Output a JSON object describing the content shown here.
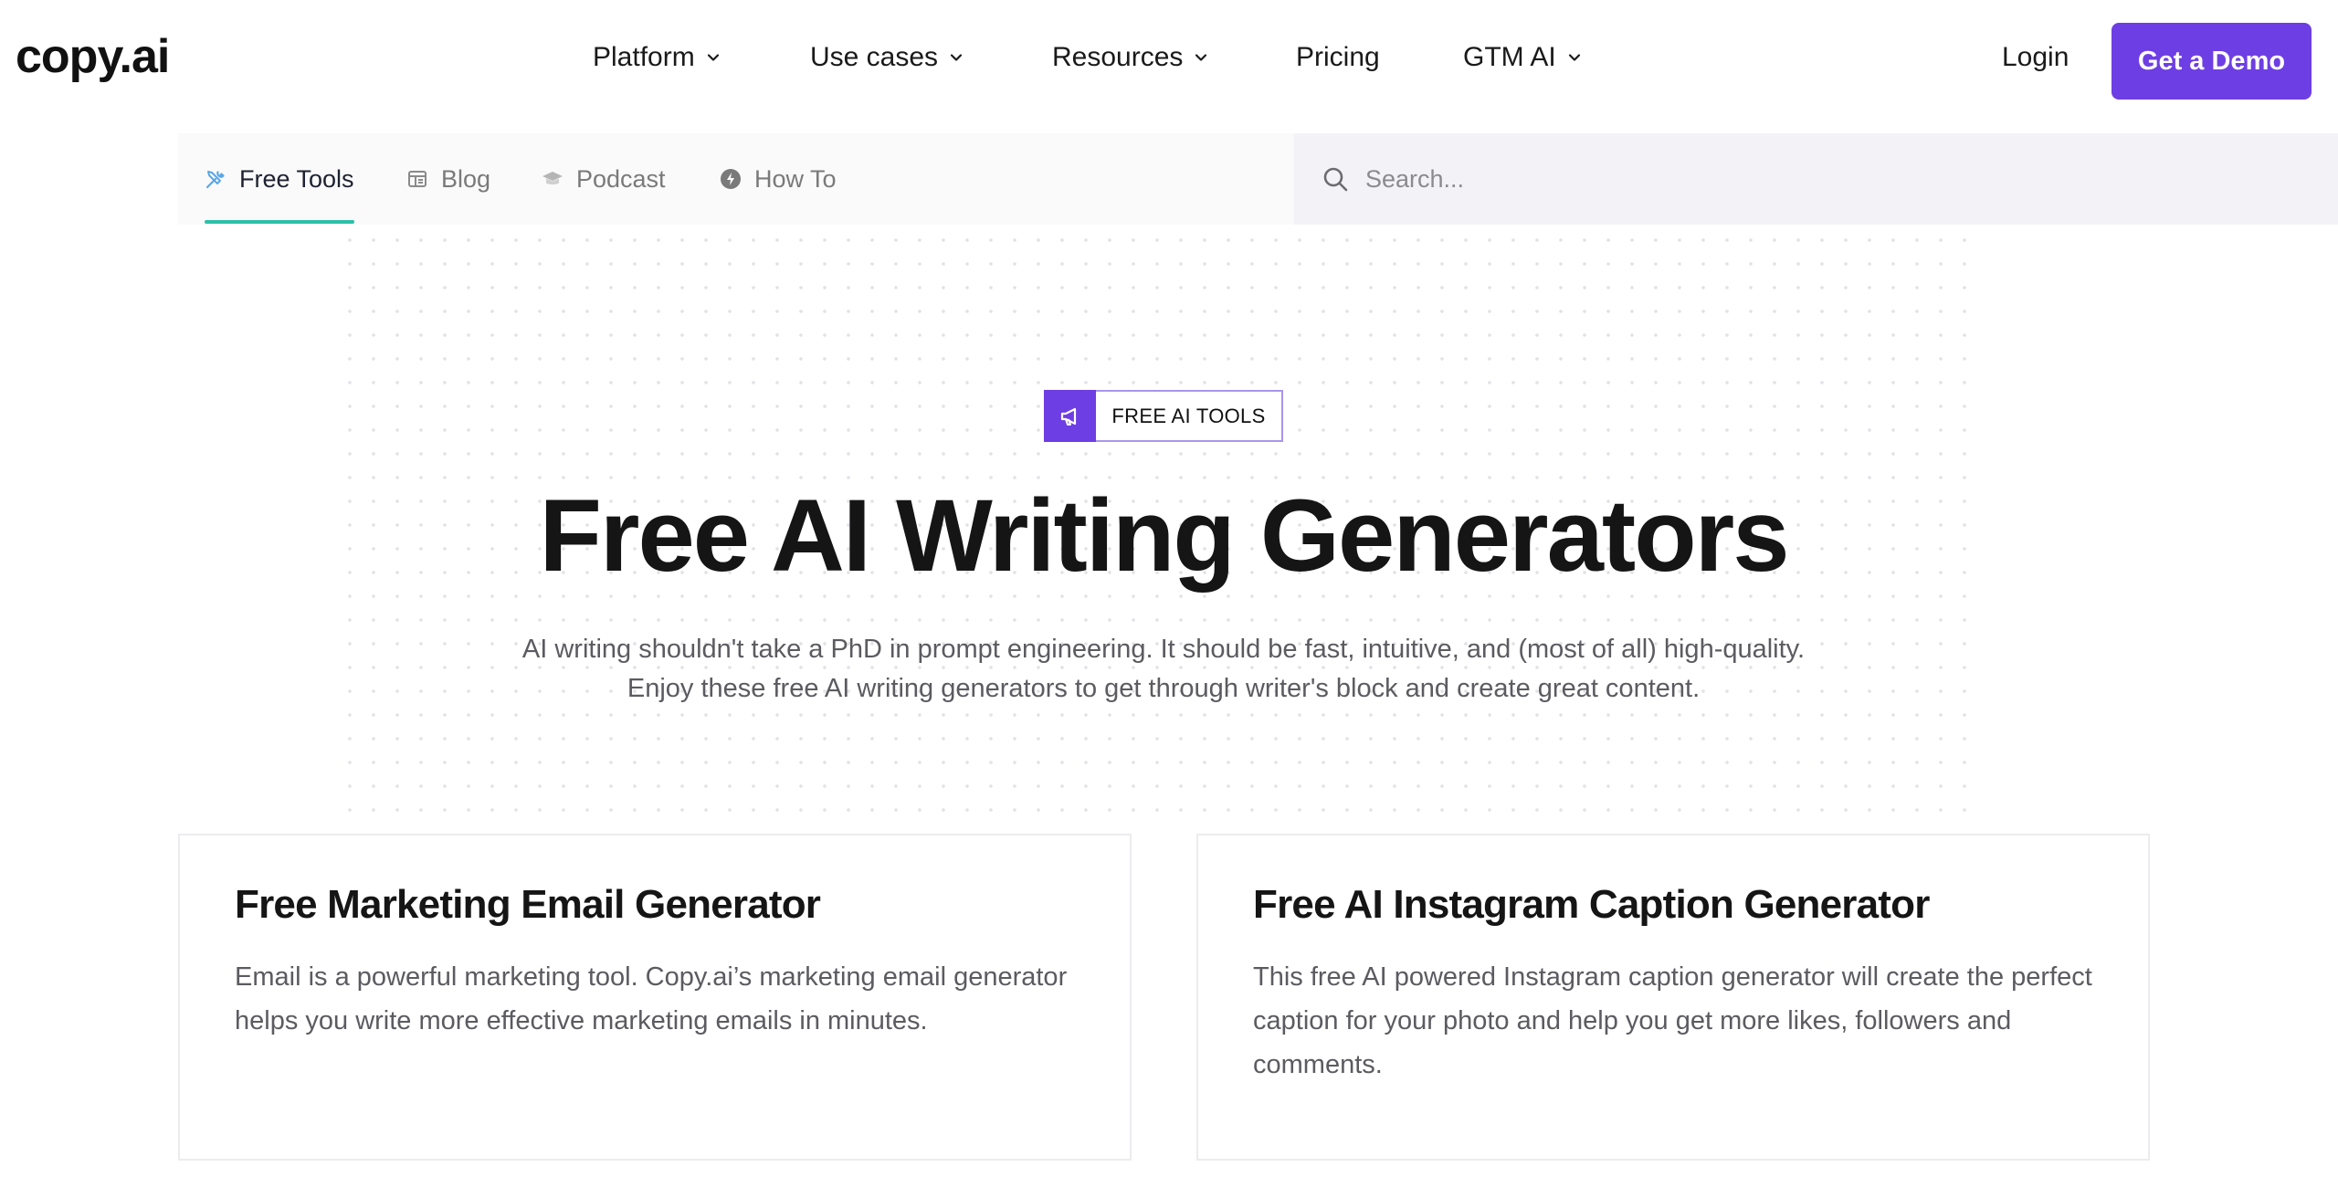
{
  "brand": {
    "logo": "copy.ai",
    "accent": "#6d3ee3",
    "tab_underline": "#2cc0a8"
  },
  "topnav": {
    "items": [
      {
        "label": "Platform",
        "has_dropdown": true
      },
      {
        "label": "Use cases",
        "has_dropdown": true
      },
      {
        "label": "Resources",
        "has_dropdown": true
      },
      {
        "label": "Pricing",
        "has_dropdown": false
      },
      {
        "label": "GTM AI",
        "has_dropdown": true
      }
    ],
    "login": "Login",
    "cta": "Get a Demo"
  },
  "subnav": {
    "tabs": [
      {
        "label": "Free Tools",
        "icon": "tools-icon",
        "active": true
      },
      {
        "label": "Blog",
        "icon": "newspaper-icon",
        "active": false
      },
      {
        "label": "Podcast",
        "icon": "graduation-cap-icon",
        "active": false
      },
      {
        "label": "How To",
        "icon": "lightning-circle-icon",
        "active": false
      }
    ],
    "search_placeholder": "Search..."
  },
  "hero": {
    "badge_icon": "megaphone-icon",
    "badge": "FREE AI TOOLS",
    "title": "Free AI Writing Generators",
    "subtitle_line1": "AI writing shouldn't take a PhD in prompt engineering. It should be fast, intuitive, and (most of all) high-quality.",
    "subtitle_line2": "Enjoy these free AI writing generators to get through writer's block and create great content."
  },
  "cards": [
    {
      "title": "Free Marketing Email Generator",
      "description": "Email is a powerful marketing tool. Copy.ai’s marketing email generator helps you write more effective marketing emails in minutes."
    },
    {
      "title": "Free AI Instagram Caption Generator",
      "description": "This free AI powered Instagram caption generator will create the perfect caption for your photo and help you get more likes, followers and comments."
    }
  ]
}
